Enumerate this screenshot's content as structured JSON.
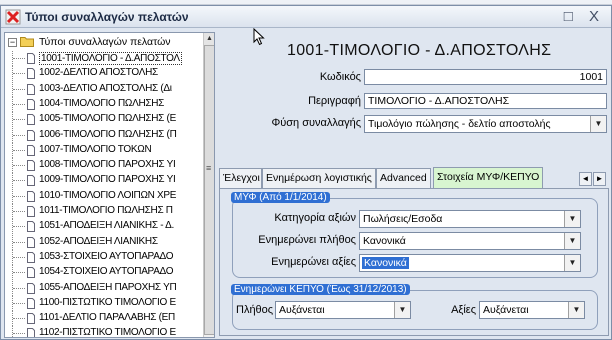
{
  "window": {
    "title": "Τύποι συναλλαγών πελατών",
    "controls": "□ X"
  },
  "tree": {
    "root_label": "Τύποι συναλλαγών πελατών",
    "expander": "−",
    "items": [
      {
        "label": "1001-ΤΙΜΟΛΟΓΙΟ - Δ.ΑΠΟΣΤΟΛ",
        "selected": true
      },
      {
        "label": "1002-ΔΕΛΤΙΟ ΑΠΟΣΤΟΛΗΣ"
      },
      {
        "label": "1003-ΔΕΛΤΙΟ ΑΠΟΣΤΟΛΗΣ (Δι"
      },
      {
        "label": "1004-ΤΙΜΟΛΟΓΙΟ ΠΩΛΗΣΗΣ"
      },
      {
        "label": "1005-ΤΙΜΟΛΟΓΙΟ ΠΩΛΗΣΗΣ (Ε"
      },
      {
        "label": "1006-ΤΙΜΟΛΟΓΙΟ ΠΩΛΗΣΗΣ (Π"
      },
      {
        "label": "1007-ΤΙΜΟΛΟΓΙΟ ΤΟΚΩΝ"
      },
      {
        "label": "1008-ΤΙΜΟΛΟΓΙΟ ΠΑΡΟΧΗΣ ΥΙ"
      },
      {
        "label": "1009-ΤΙΜΟΛΟΓΙΟ ΠΑΡΟΧΗΣ ΥΙ"
      },
      {
        "label": "1010-ΤΙΜΟΛΟΓΙΟ ΛΟΙΠΩΝ ΧΡΕ"
      },
      {
        "label": "1011-ΤΙΜΟΛΟΓΙΟ ΠΩΛΗΣΗΣ Π"
      },
      {
        "label": "1051-ΑΠΟΔΕΙΞΗ ΛΙΑΝΙΚΗΣ - Δ."
      },
      {
        "label": "1052-ΑΠΟΔΕΙΞΗ ΛΙΑΝΙΚΗΣ"
      },
      {
        "label": "1053-ΣΤΟΙΧΕΙΟ ΑΥΤΟΠΑΡΑΔΟ"
      },
      {
        "label": "1054-ΣΤΟΙΧΕΙΟ ΑΥΤΟΠΑΡΑΔΟ"
      },
      {
        "label": "1055-ΑΠΟΔΕΙΞΗ ΠΑΡΟΧΗΣ ΥΠ"
      },
      {
        "label": "1100-ΠΙΣΤΩΤΙΚΟ ΤΙΜΟΛΟΓΙΟ Ε"
      },
      {
        "label": "1101-ΔΕΛΤΙΟ ΠΑΡΑΛΑΒΗΣ (ΕΠ"
      },
      {
        "label": "1102-ΠΙΣΤΩΤΙΚΟ ΤΙΜΟΛΟΓΙΟ Ε"
      }
    ]
  },
  "detail": {
    "heading": "1001-ΤΙΜΟΛΟΓΙΟ - Δ.ΑΠΟΣΤΟΛΗΣ",
    "code_label": "Κωδικός",
    "code_value": "1001",
    "description_label": "Περιγραφή",
    "description_value": "ΤΙΜΟΛΟΓΙΟ - Δ.ΑΠΟΣΤΟΛΗΣ",
    "nature_label": "Φύση συναλλαγής",
    "nature_value": "Τιμολόγιο πώλησης - δελτίο αποστολής"
  },
  "tabs": [
    {
      "label": "Έλεγχοι"
    },
    {
      "label": "Ενημέρωση λογιστικής"
    },
    {
      "label": "Advanced"
    },
    {
      "label": "Στοιχεία ΜΥΦ/ΚΕΠΥΟ",
      "active": true
    }
  ],
  "tab_scroll": {
    "left": "◄",
    "right": "►"
  },
  "myf": {
    "legend": "ΜΥΦ (Από 1/1/2014)",
    "category_label": "Κατηγορία αξιών",
    "category_value": "Πωλήσεις/Εσοδα",
    "updates_qty_label": "Ενημερώνει πλήθος",
    "updates_qty_value": "Κανονικά",
    "updates_values_label": "Ενημερώνει αξίες",
    "updates_values_value": "Κανονικά"
  },
  "kepyo": {
    "legend": "Ενημερώνει ΚΕΠΥΟ (Έως 31/12/2013)",
    "qty_label": "Πλήθος",
    "qty_value": "Αυξάνεται",
    "values_label": "Αξίες",
    "values_value": "Αυξάνεται"
  },
  "dropdown_glyph": "▼",
  "scroll_up_glyph": "▲",
  "scroll_grip_glyph": "≡",
  "colors": {
    "accent": "#2f6fd3",
    "active_tab": "#d8f5d0",
    "window_bg": "#dfe6f0"
  }
}
